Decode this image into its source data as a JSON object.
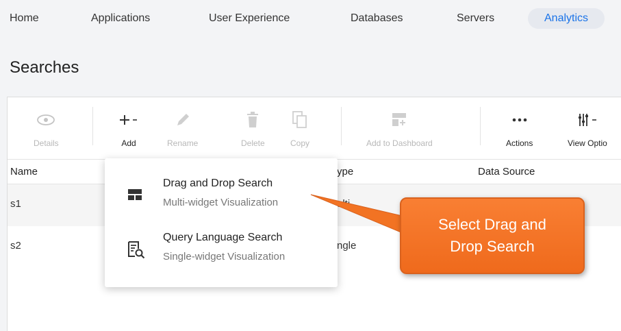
{
  "nav": {
    "items": [
      "Home",
      "Applications",
      "User Experience",
      "Databases",
      "Servers",
      "Analytics"
    ],
    "active": "Analytics"
  },
  "page": {
    "title": "Searches"
  },
  "toolbar": {
    "details": "Details",
    "add": "Add",
    "rename": "Rename",
    "delete": "Delete",
    "copy": "Copy",
    "add_to_dashboard": "Add to Dashboard",
    "actions": "Actions",
    "view_options": "View Optio"
  },
  "table": {
    "columns": {
      "name": "Name",
      "type": "ype",
      "data_source": "Data Source"
    },
    "rows": [
      {
        "name": "s1",
        "type": "ulti"
      },
      {
        "name": "s2",
        "type": "ngle"
      }
    ]
  },
  "add_menu": {
    "items": [
      {
        "title": "Drag and Drop Search",
        "subtitle": "Multi-widget Visualization",
        "icon": "layout-grid-icon"
      },
      {
        "title": "Query Language Search",
        "subtitle": "Single-widget Visualization",
        "icon": "query-search-icon"
      }
    ]
  },
  "callout": {
    "text": "Select Drag and Drop Search"
  },
  "colors": {
    "accent": "#1a73e8",
    "callout": "#f5782a",
    "disabled": "#b8b8b8"
  }
}
